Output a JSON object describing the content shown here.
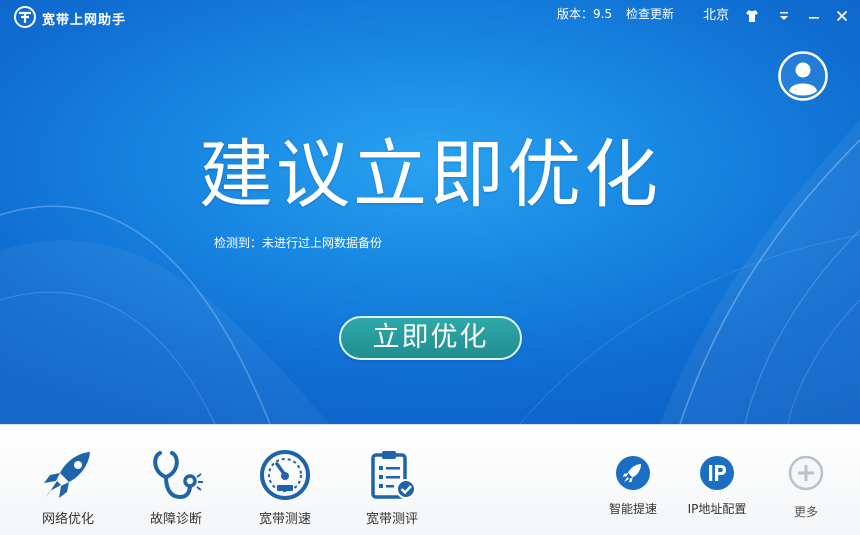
{
  "titlebar": {
    "app_title": "宽带上网助手",
    "version": "版本：9.5",
    "check_update": "检查更新",
    "city": "北京"
  },
  "hero": {
    "headline": "建议立即优化",
    "detect_label": "检测到：",
    "detect_value": "未进行过上网数据备份",
    "optimize_button": "立即优化"
  },
  "toolbar": {
    "tools": [
      {
        "label": "网络优化",
        "icon": "rocket-icon"
      },
      {
        "label": "故障诊断",
        "icon": "stethoscope-icon"
      },
      {
        "label": "宽带测速",
        "icon": "speedometer-icon"
      },
      {
        "label": "宽带测评",
        "icon": "clipboard-check-icon"
      }
    ],
    "mini_tools": [
      {
        "label": "智能提速",
        "icon": "rocket-badge-icon"
      },
      {
        "label": "IP地址配置",
        "icon": "ip-badge-icon"
      },
      {
        "label": "更多",
        "icon": "plus-circle-icon"
      }
    ]
  },
  "colors": {
    "hero_blue": "#1887e2",
    "button_teal": "#1f8e8f",
    "icon_blue": "#1f63a8",
    "badge_blue": "#1a6fc2"
  }
}
